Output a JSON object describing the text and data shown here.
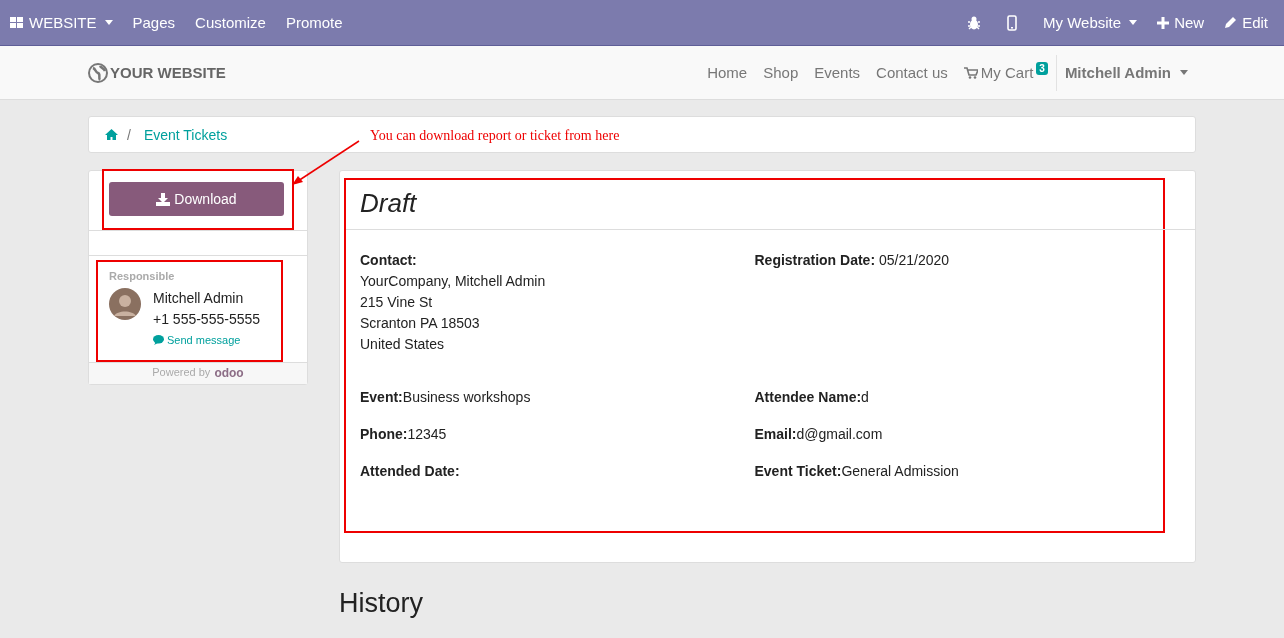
{
  "topbar": {
    "apps_menu": "WEBSITE",
    "items": [
      "Pages",
      "Customize",
      "Promote"
    ],
    "website_menu": "My Website",
    "new_button": "New",
    "edit_button": "Edit"
  },
  "navbar": {
    "logo": "YOUR WEBSITE",
    "links": [
      "Home",
      "Shop",
      "Events",
      "Contact us"
    ],
    "cart": {
      "label": "My Cart",
      "count": "3"
    },
    "user": "Mitchell Admin"
  },
  "breadcrumb": {
    "separator": "/",
    "items": [
      "Event Tickets"
    ]
  },
  "annotation": "You can download report or ticket from here",
  "sidebar": {
    "download_button": "Download",
    "responsible": {
      "heading": "Responsible",
      "name": "Mitchell Admin",
      "phone": "+1 555-555-5555",
      "send_message": "Send message"
    },
    "powered_by": "Powered by",
    "brand": "odoo"
  },
  "detail": {
    "title": "Draft",
    "contact": {
      "label": "Contact:",
      "lines": [
        "YourCompany, Mitchell Admin",
        "215 Vine St",
        "Scranton PA 18503",
        "United States"
      ]
    },
    "registration_date": {
      "label": "Registration Date:",
      "value": "05/21/2020"
    },
    "fields": [
      {
        "label": "Event:",
        "value": "Business workshops"
      },
      {
        "label": "Attendee Name:",
        "value": "d"
      },
      {
        "label": "Phone:",
        "value": "12345"
      },
      {
        "label": "Email:",
        "value": "d@gmail.com"
      },
      {
        "label": "Attended Date:"
      },
      {
        "label": "Event Ticket:",
        "value": "General Admission"
      }
    ]
  },
  "history": {
    "title": "History"
  }
}
